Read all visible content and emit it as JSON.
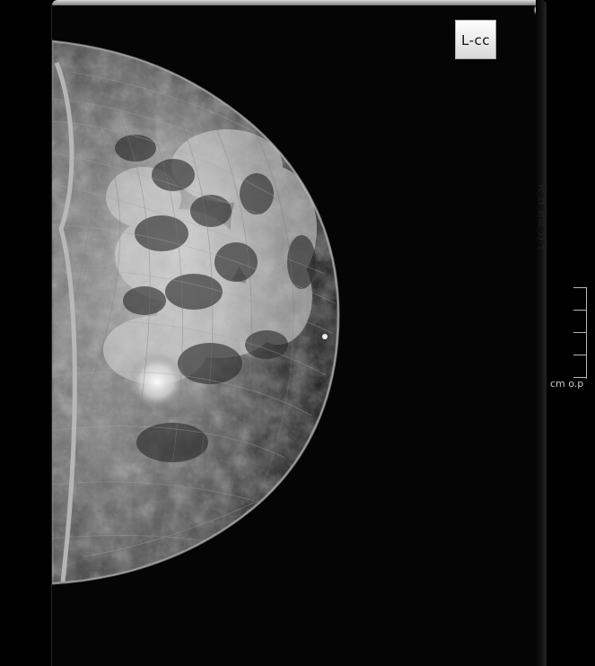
{
  "viewer": {
    "view_label": "L-cc",
    "scale_label": "cm o.p",
    "side_marker_text": "L-CC 2018 12 34"
  },
  "colors": {
    "background": "#000000",
    "film": "#050505",
    "tissue_highlight": "#d8d8d8",
    "skin_edge": "#8c8c8c"
  },
  "scale": {
    "ticks": 5,
    "unit": "cm"
  }
}
